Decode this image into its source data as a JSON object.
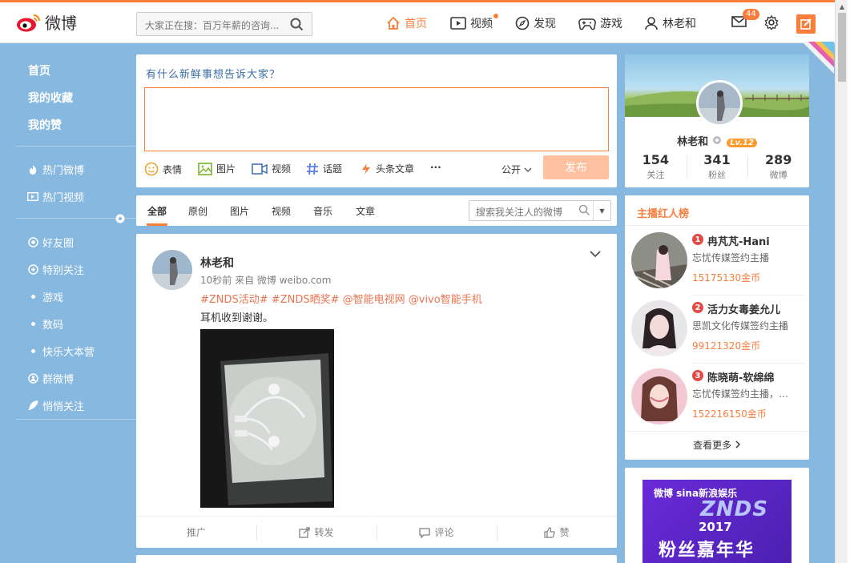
{
  "header": {
    "logo_text": "微博",
    "search_placeholder": "大家正在搜：百万年薪的咨询...",
    "nav": {
      "home": "首页",
      "video": "视频",
      "discover": "发现",
      "games": "游戏",
      "user": "林老和"
    },
    "message_badge": "44"
  },
  "sidebar": {
    "top": [
      "首页",
      "我的收藏",
      "我的赞"
    ],
    "hot": [
      "热门微博",
      "热门视频"
    ],
    "groups": [
      "好友圈",
      "特别关注",
      "游戏",
      "数码",
      "快乐大本营",
      "群微博",
      "悄悄关注"
    ]
  },
  "publish": {
    "prompt": "有什么新鲜事想告诉大家？",
    "tools": [
      "表情",
      "图片",
      "视频",
      "话题",
      "头条文章"
    ],
    "more": "···",
    "scope": "公开",
    "submit": "发布"
  },
  "tabs": {
    "items": [
      "全部",
      "原创",
      "图片",
      "视频",
      "音乐",
      "文章"
    ],
    "search_placeholder": "搜索我关注人的微博"
  },
  "post": {
    "author": "林老和",
    "meta": "10秒前 来自 微博 weibo.com",
    "tags": "#ZNDS活动# #ZNDS晒奖# @智能电视网 @vivo智能手机",
    "text": "耳机收到谢谢。",
    "actions": [
      "推广",
      "转发",
      "评论",
      "赞"
    ]
  },
  "profile": {
    "name": "林老和",
    "level": "Lv.12",
    "stats": [
      {
        "num": "154",
        "label": "关注"
      },
      {
        "num": "341",
        "label": "粉丝"
      },
      {
        "num": "289",
        "label": "微博"
      }
    ]
  },
  "anchors": {
    "title": "主播红人榜",
    "list": [
      {
        "rank": "1",
        "name": "冉芃芃-Hani",
        "desc": "忘忧传媒签约主播",
        "coins": "15175130金币"
      },
      {
        "rank": "2",
        "name": "活力女毒姜允儿",
        "desc": "思凯文化传媒签约主播",
        "coins": "99121320金币"
      },
      {
        "rank": "3",
        "name": "陈晓萌-软绵绵",
        "desc": "忘忧传媒签约主播，…",
        "coins": "152216150金币"
      }
    ],
    "more": "查看更多"
  },
  "ad": {
    "brand": "微博  sina新浪娱乐",
    "znds": "ZNDS",
    "year": "2017",
    "event": "粉丝嘉年华"
  },
  "colors": {
    "accent": "#fa7d3c",
    "sidebar_bg": "#86b8e0",
    "tag": "#eb7350"
  }
}
